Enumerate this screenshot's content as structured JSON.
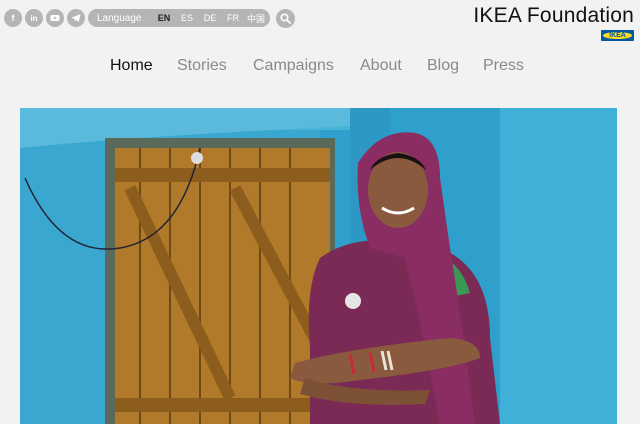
{
  "social": [
    {
      "icon": "facebook-icon",
      "glyph": "f"
    },
    {
      "icon": "linkedin-icon",
      "glyph": "in"
    },
    {
      "icon": "youtube-icon",
      "glyph": "▶"
    },
    {
      "icon": "telegram-icon",
      "glyph": "➤"
    }
  ],
  "language": {
    "label": "Language",
    "options": [
      "EN",
      "ES",
      "DE",
      "FR",
      "中国"
    ],
    "selected": "EN"
  },
  "search": {
    "icon": "search-icon"
  },
  "brand": {
    "title": "IKEA Foundation",
    "logo_text": "IKEA"
  },
  "nav": {
    "items": [
      {
        "label": "Home",
        "active": true
      },
      {
        "label": "Stories",
        "active": false
      },
      {
        "label": "Campaigns",
        "active": false
      },
      {
        "label": "About",
        "active": false
      },
      {
        "label": "Blog",
        "active": false
      },
      {
        "label": "Press",
        "active": false
      }
    ]
  },
  "colors": {
    "accent_active": "#111111",
    "nav_inactive": "#8a8a8a",
    "pill_bg": "#b5b5b5",
    "ikea_blue": "#0058a3",
    "ikea_yellow": "#ffda1a"
  }
}
